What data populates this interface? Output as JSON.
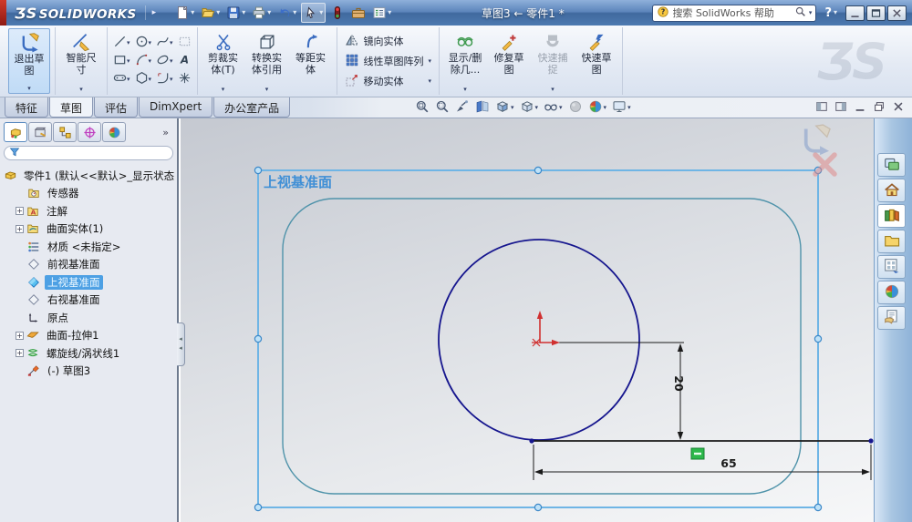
{
  "title_bar": {
    "brand_glyph": "ƷS",
    "brand": "SOLIDWORKS",
    "document_title": "草图3 ← 零件1 *",
    "search_placeholder": "搜索 SolidWorks 帮助",
    "help_glyph": "?",
    "toolbar": [
      {
        "name": "new-document",
        "dropdown": true
      },
      {
        "name": "open",
        "dropdown": true
      },
      {
        "name": "save",
        "dropdown": true
      },
      {
        "name": "print",
        "dropdown": true
      },
      {
        "name": "undo",
        "dropdown": true
      },
      {
        "name": "select",
        "dropdown": true,
        "boxed": true
      },
      {
        "name": "instant3d"
      },
      {
        "name": "toolbox"
      },
      {
        "name": "options",
        "dropdown": true
      }
    ],
    "window_buttons": [
      "minimize",
      "maximize",
      "close"
    ]
  },
  "ribbon": {
    "exit_sketch": "退出草图",
    "smart_dimension": "智能尺寸",
    "trim": "剪裁实体(T)",
    "convert": "转换实体引用",
    "offset": "等距实体",
    "mirror": "镜向实体",
    "linear_pattern": "线性草图阵列",
    "move": "移动实体",
    "display_delete": "显示/删除几...",
    "repair": "修复草图",
    "quick_snaps": "快速捕捉",
    "rapid_sketch": "快速草图",
    "watermark": "ƷS",
    "sketch_tools": [
      {
        "icon": "line",
        "dropdown": true
      },
      {
        "icon": "circle",
        "dropdown": true
      },
      {
        "icon": "spline",
        "dropdown": true
      },
      {
        "icon": "select-box"
      },
      {
        "icon": "rectangle",
        "dropdown": true
      },
      {
        "icon": "arc",
        "dropdown": true
      },
      {
        "icon": "ellipse",
        "dropdown": true
      },
      {
        "icon": "text"
      },
      {
        "icon": "slot",
        "dropdown": true
      },
      {
        "icon": "polygon",
        "dropdown": true
      },
      {
        "icon": "fillet",
        "dropdown": true
      },
      {
        "icon": "point"
      }
    ]
  },
  "tabs": {
    "items": [
      {
        "label": "特征"
      },
      {
        "label": "草图",
        "active": true
      },
      {
        "label": "评估"
      },
      {
        "label": "DimXpert"
      },
      {
        "label": "办公室产品"
      }
    ]
  },
  "headsup": [
    {
      "name": "zoom-fit"
    },
    {
      "name": "zoom-area"
    },
    {
      "name": "zoom-selected"
    },
    {
      "name": "section-view"
    },
    {
      "name": "view-orientation",
      "dropdown": true
    },
    {
      "name": "display-style",
      "dropdown": true
    },
    {
      "name": "hide-show-items",
      "dropdown": true
    },
    {
      "name": "edit-appearance",
      "disabled": true
    },
    {
      "name": "apply-scene",
      "dropdown": true
    },
    {
      "name": "view-settings",
      "dropdown": true
    }
  ],
  "doc_window_controls": [
    "viewport-left",
    "viewport-right",
    "minimize",
    "restore",
    "close"
  ],
  "feature_manager": {
    "tabs": [
      {
        "name": "feature-tree",
        "active": true
      },
      {
        "name": "property-manager"
      },
      {
        "name": "configuration-manager"
      },
      {
        "name": "dimxpert-manager"
      },
      {
        "name": "display-manager"
      }
    ],
    "more_glyph": "»",
    "root_label": "零件1 (默认<<默认>_显示状态",
    "items": [
      {
        "label": "传感器",
        "icon": "sensors"
      },
      {
        "label": "注解",
        "icon": "annotations",
        "expandable": true
      },
      {
        "label": "曲面实体(1)",
        "icon": "surface-folder",
        "expandable": true
      },
      {
        "label": "材质 <未指定>",
        "icon": "material"
      },
      {
        "label": "前视基准面",
        "icon": "plane"
      },
      {
        "label": "上视基准面",
        "icon": "plane",
        "selected": true
      },
      {
        "label": "右视基准面",
        "icon": "plane"
      },
      {
        "label": "原点",
        "icon": "origin"
      },
      {
        "label": "曲面-拉伸1",
        "icon": "surface-extrude",
        "expandable": true
      },
      {
        "label": "螺旋线/涡状线1",
        "icon": "helix",
        "expandable": true
      },
      {
        "label": "(-) 草图3",
        "icon": "sketch"
      }
    ]
  },
  "viewport": {
    "plane_label": "上视基准面",
    "dim_vertical": "20",
    "dim_horizontal": "65",
    "colors": {
      "plane_border": "#6fb5e5",
      "profile_teal": "#4f93aa",
      "circle_navy": "#16168e",
      "dimension_black": "#1a1a1a",
      "relation_green": "#2db84b",
      "origin_red": "#d03030",
      "plane_label_blue": "#3f8fd6"
    }
  },
  "task_pane": [
    {
      "name": "solidworks-resources"
    },
    {
      "name": "home"
    },
    {
      "name": "design-library",
      "active": true
    },
    {
      "name": "file-explorer"
    },
    {
      "name": "view-palette"
    },
    {
      "name": "appearances-scenes"
    },
    {
      "name": "custom-properties"
    }
  ]
}
